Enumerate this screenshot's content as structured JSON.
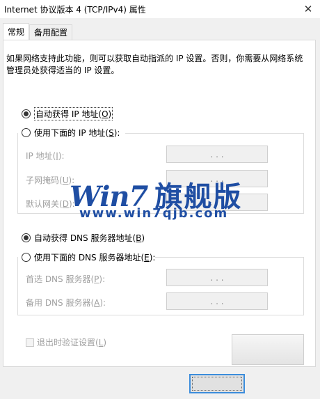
{
  "window": {
    "title": "Internet 协议版本 4 (TCP/IPv4) 属性",
    "close_glyph": "✕"
  },
  "tabs": [
    {
      "label": "常规",
      "active": true
    },
    {
      "label": "备用配置",
      "active": false
    }
  ],
  "description": "如果网络支持此功能，则可以获取自动指派的 IP 设置。否则，你需要从网络系统管理员处获得适当的 IP 设置。",
  "ip_section": {
    "auto_option": {
      "label": "自动获得 IP 地址(",
      "key": "O",
      "suffix": ")",
      "selected": true
    },
    "manual_option": {
      "label": "使用下面的 IP 地址(",
      "key": "S",
      "suffix": "):",
      "selected": false
    },
    "fields": [
      {
        "label": "IP 地址(",
        "key": "I",
        "suffix": "):",
        "dots": ".      .      ."
      },
      {
        "label": "子网掩码(",
        "key": "U",
        "suffix": "):",
        "dots": ".      .      ."
      },
      {
        "label": "默认网关(",
        "key": "D",
        "suffix": "):",
        "dots": ".      .      ."
      }
    ]
  },
  "dns_section": {
    "auto_option": {
      "label": "自动获得 DNS 服务器地址(",
      "key": "B",
      "suffix": ")",
      "selected": true
    },
    "manual_option": {
      "label": "使用下面的 DNS 服务器地址(",
      "key": "E",
      "suffix": "):",
      "selected": false
    },
    "fields": [
      {
        "label": "首选 DNS 服务器(",
        "key": "P",
        "suffix": "):",
        "dots": ".      .      ."
      },
      {
        "label": "备用 DNS 服务器(",
        "key": "A",
        "suffix": "):",
        "dots": ".      .      ."
      }
    ]
  },
  "validate_checkbox": {
    "label": "退出时验证设置(",
    "key": "L",
    "suffix": ")",
    "checked": false
  },
  "watermark": {
    "logo_text": "Win7",
    "cn_text": "旗舰版",
    "url": "www.win7qjb.com",
    "color": "#1f4ea3"
  },
  "colors": {
    "background": "#f0f0f0",
    "panel": "#ffffff",
    "disabled_text": "#a0a0a0",
    "focus_border": "#3c8ddc"
  }
}
